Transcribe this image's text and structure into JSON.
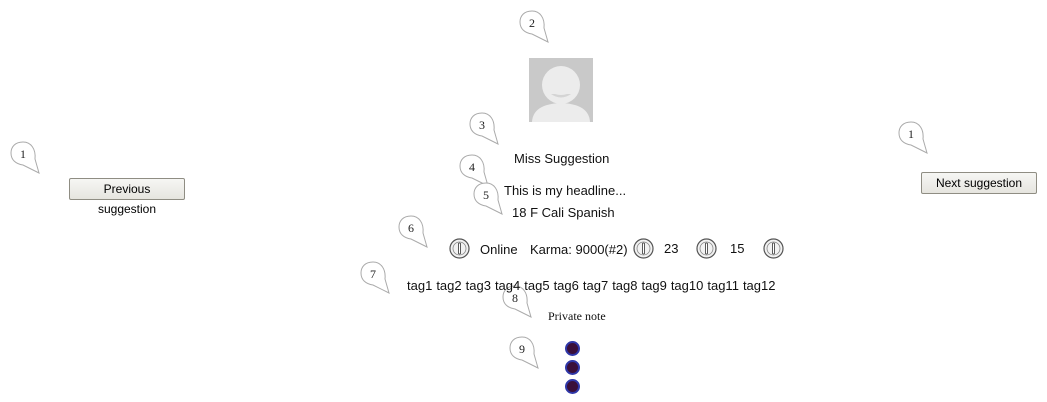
{
  "callouts": {
    "c_prev": "1",
    "c_next": "1",
    "c_avatar": "2",
    "c_name": "3",
    "c_headline": "4",
    "c_details": "5",
    "c_status": "6",
    "c_tags": "7",
    "c_note": "8",
    "c_dots": "9"
  },
  "nav": {
    "prev_label": "Previous suggestion",
    "next_label": "Next suggestion"
  },
  "profile": {
    "name": "Miss Suggestion",
    "headline": "This is my headline...",
    "details": "18 F Cali Spanish",
    "status": "Online",
    "karma": "Karma: 9000(#2)",
    "count_a": "23",
    "count_b": "15"
  },
  "tags": [
    "tag1",
    "tag2",
    "tag3",
    "tag4",
    "tag5",
    "tag6",
    "tag7",
    "tag8",
    "tag9",
    "tag10",
    "tag11",
    "tag12"
  ],
  "private_note_label": "Private note",
  "icons": {
    "info": "info-icon",
    "avatar": "avatar-placeholder-icon"
  },
  "colors": {
    "dot_fill": "#3a0f3a",
    "dot_ring": "#2f37a8"
  }
}
